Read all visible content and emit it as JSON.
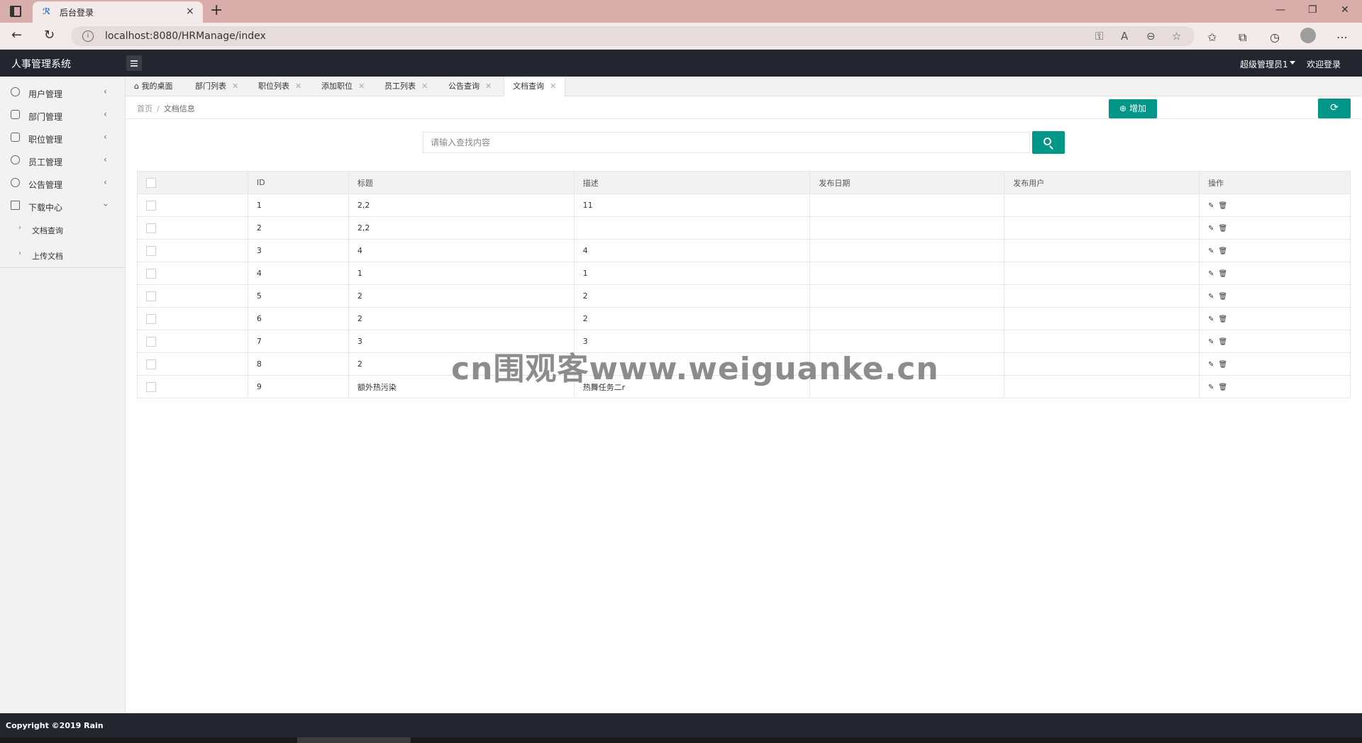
{
  "browser": {
    "tab_title": "后台登录",
    "tab_close": "×",
    "new_tab": "+",
    "url": "localhost:8080/HRManage/index",
    "win_minimize": "—",
    "win_restore": "❐",
    "win_close": "✕"
  },
  "header": {
    "logo": "人事管理系统",
    "user": "超级管理员1",
    "welcome": "欢迎登录"
  },
  "sidebar": {
    "items": [
      {
        "label": "用户管理",
        "icon": "user-icon"
      },
      {
        "label": "部门管理",
        "icon": "department-icon"
      },
      {
        "label": "职位管理",
        "icon": "position-icon"
      },
      {
        "label": "员工管理",
        "icon": "employee-icon"
      },
      {
        "label": "公告管理",
        "icon": "notice-icon"
      },
      {
        "label": "下载中心",
        "icon": "download-icon"
      }
    ],
    "sub_items": [
      {
        "label": "文档查询"
      },
      {
        "label": "上传文档"
      }
    ]
  },
  "tabs": [
    {
      "label": "我的桌面"
    },
    {
      "label": "部门列表"
    },
    {
      "label": "职位列表"
    },
    {
      "label": "添加职位"
    },
    {
      "label": "员工列表"
    },
    {
      "label": "公告查询"
    },
    {
      "label": "文档查询"
    }
  ],
  "breadcrumb": {
    "home": "首页",
    "separator": "/",
    "current": "文档信息"
  },
  "toolbar": {
    "add_label": "增加"
  },
  "search": {
    "placeholder": "请输入查找内容"
  },
  "table": {
    "columns": [
      "ID",
      "标题",
      "描述",
      "发布日期",
      "发布用户",
      "操作"
    ],
    "rows": [
      {
        "id": "1",
        "title": "2,2",
        "desc": "11",
        "date": "",
        "user": ""
      },
      {
        "id": "2",
        "title": "2,2",
        "desc": "",
        "date": "",
        "user": ""
      },
      {
        "id": "3",
        "title": "4",
        "desc": "4",
        "date": "",
        "user": ""
      },
      {
        "id": "4",
        "title": "1",
        "desc": "1",
        "date": "",
        "user": ""
      },
      {
        "id": "5",
        "title": "2",
        "desc": "2",
        "date": "",
        "user": ""
      },
      {
        "id": "6",
        "title": "2",
        "desc": "2",
        "date": "",
        "user": ""
      },
      {
        "id": "7",
        "title": "3",
        "desc": "3",
        "date": "",
        "user": ""
      },
      {
        "id": "8",
        "title": "2",
        "desc": "",
        "date": "",
        "user": ""
      },
      {
        "id": "9",
        "title": "额外热污染",
        "desc": "热舞任务二r",
        "date": "",
        "user": ""
      }
    ]
  },
  "watermark": "cn围观客www.weiguanke.cn",
  "footer": {
    "copyright": "Copyright ©2019 Rain"
  },
  "colors": {
    "accent": "#009688",
    "header_bg": "#23262e",
    "titlebar_bg": "#d9aeaa"
  }
}
